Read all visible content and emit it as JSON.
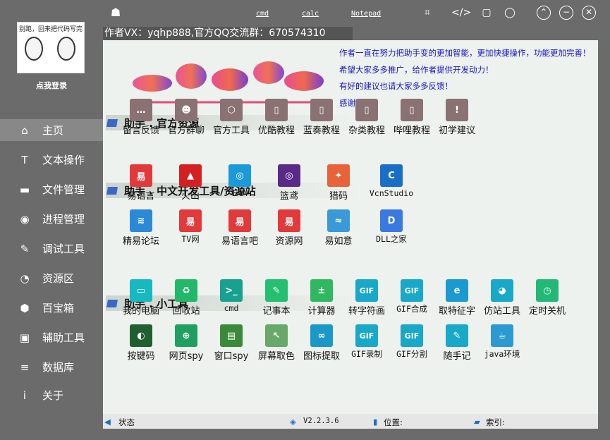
{
  "login": {
    "avatar_caption": "别跑，回来把代码写完",
    "label": "点我登录"
  },
  "nav": [
    {
      "label": "主页",
      "icon": "⌂",
      "icon_name": "home-icon",
      "active": true
    },
    {
      "label": "文本操作",
      "icon": "T",
      "icon_name": "text-icon"
    },
    {
      "label": "文件管理",
      "icon": "▬",
      "icon_name": "folder-icon"
    },
    {
      "label": "进程管理",
      "icon": "◉",
      "icon_name": "process-icon"
    },
    {
      "label": "调试工具",
      "icon": "✎",
      "icon_name": "wrench-icon"
    },
    {
      "label": "资源区",
      "icon": "◔",
      "icon_name": "pie-icon"
    },
    {
      "label": "百宝箱",
      "icon": "⬢",
      "icon_name": "box-icon"
    },
    {
      "label": "辅助工具",
      "icon": "▣",
      "icon_name": "briefcase-icon"
    },
    {
      "label": "数据库",
      "icon": "≡",
      "icon_name": "database-icon"
    },
    {
      "label": "关于",
      "icon": "i",
      "icon_name": "info-icon"
    }
  ],
  "topbar": {
    "links": [
      "cmd",
      "calc",
      "Notepad"
    ]
  },
  "author_line": "作者VX：yqhp888,官方QQ交流群：670574310",
  "notes": [
    "作者一直在努力把助手变的更加智能，更加快捷操作，功能更加完善！",
    "希望大家多多推广，给作者提供开发动力！",
    "有好的建议也请大家多多反馈！",
    "感谢支持！"
  ],
  "sections": [
    {
      "title": "助手 .  官方资源",
      "items": [
        {
          "label": "留言反馈",
          "glyph": "…",
          "color": "#8a7272"
        },
        {
          "label": "官方群聊",
          "glyph": "☻",
          "color": "#8a7272"
        },
        {
          "label": "官方工具",
          "glyph": "⬡",
          "color": "#8a7272"
        },
        {
          "label": "优酷教程",
          "glyph": "▯",
          "color": "#8a7272"
        },
        {
          "label": "蓝奏教程",
          "glyph": "▯",
          "color": "#8a7272"
        },
        {
          "label": "杂类教程",
          "glyph": "▯",
          "color": "#8a7272"
        },
        {
          "label": "哔哩教程",
          "glyph": "▯",
          "color": "#8a7272"
        },
        {
          "label": "初学建议",
          "glyph": "!",
          "color": "#8a7272"
        }
      ]
    },
    {
      "title": "助手 .  中文开发工具/资源站",
      "items": [
        {
          "label": "易语言",
          "glyph": "易",
          "color": "#e23a3a"
        },
        {
          "label": "火山",
          "glyph": "▲",
          "color": "#d42020"
        },
        {
          "label": "E4A",
          "glyph": "◎",
          "color": "#1a9ad8"
        },
        {
          "label": "篮鸢",
          "glyph": "◎",
          "color": "#5a2a8a"
        },
        {
          "label": "猎码",
          "glyph": "✦",
          "color": "#e8623a"
        },
        {
          "label": "VcnStudio",
          "glyph": "C",
          "color": "#1a6ec8"
        },
        {
          "label": "精易论坛",
          "glyph": "≋",
          "color": "#2a8ad8"
        },
        {
          "label": "TV网",
          "glyph": "易",
          "color": "#e23a3a"
        },
        {
          "label": "易语言吧",
          "glyph": "易",
          "color": "#e23a3a"
        },
        {
          "label": "资源网",
          "glyph": "易",
          "color": "#e23a3a"
        },
        {
          "label": "易如意",
          "glyph": "≈",
          "color": "#3a9ad8"
        },
        {
          "label": "DLL之家",
          "glyph": "D",
          "color": "#3a7ae0"
        }
      ]
    },
    {
      "title": "助手 .  小工具",
      "items": [
        {
          "label": "我的电脑",
          "glyph": "▭",
          "color": "#18b8c0"
        },
        {
          "label": "回收站",
          "glyph": "♻",
          "color": "#22b86a"
        },
        {
          "label": "cmd",
          "glyph": ">_",
          "color": "#18a090"
        },
        {
          "label": "记事本",
          "glyph": "✎",
          "color": "#22c070"
        },
        {
          "label": "计算器",
          "glyph": "±",
          "color": "#30b860"
        },
        {
          "label": "转字符画",
          "glyph": "GIF",
          "color": "#18a8c8"
        },
        {
          "label": "GIF合成",
          "glyph": "GIF",
          "color": "#18a8c8"
        },
        {
          "label": "取特征字",
          "glyph": "e",
          "color": "#1a9ad0"
        },
        {
          "label": "仿站工具",
          "glyph": "◕",
          "color": "#18a8c8"
        },
        {
          "label": "定时关机",
          "glyph": "◷",
          "color": "#22b878"
        },
        {
          "label": "按键码",
          "glyph": "◐",
          "color": "#206030"
        },
        {
          "label": "网页spy",
          "glyph": "⊕",
          "color": "#20a060"
        },
        {
          "label": "窗口spy",
          "glyph": "▤",
          "color": "#3a8a3a"
        },
        {
          "label": "屏幕取色",
          "glyph": "↖",
          "color": "#68a868"
        },
        {
          "label": "图标提取",
          "glyph": "∞",
          "color": "#1a98c8"
        },
        {
          "label": "GIF录制",
          "glyph": "GIF",
          "color": "#18a8c8"
        },
        {
          "label": "GIF分割",
          "glyph": "GIF",
          "color": "#18a8c8"
        },
        {
          "label": "随手记",
          "glyph": "✎",
          "color": "#18a8c8"
        },
        {
          "label": "java环境",
          "glyph": "☕",
          "color": "#2a9ad0"
        }
      ]
    }
  ],
  "statusbar": {
    "status": "状态",
    "version": "V2.2.3.6",
    "position": "位置:",
    "index": "索引:"
  }
}
